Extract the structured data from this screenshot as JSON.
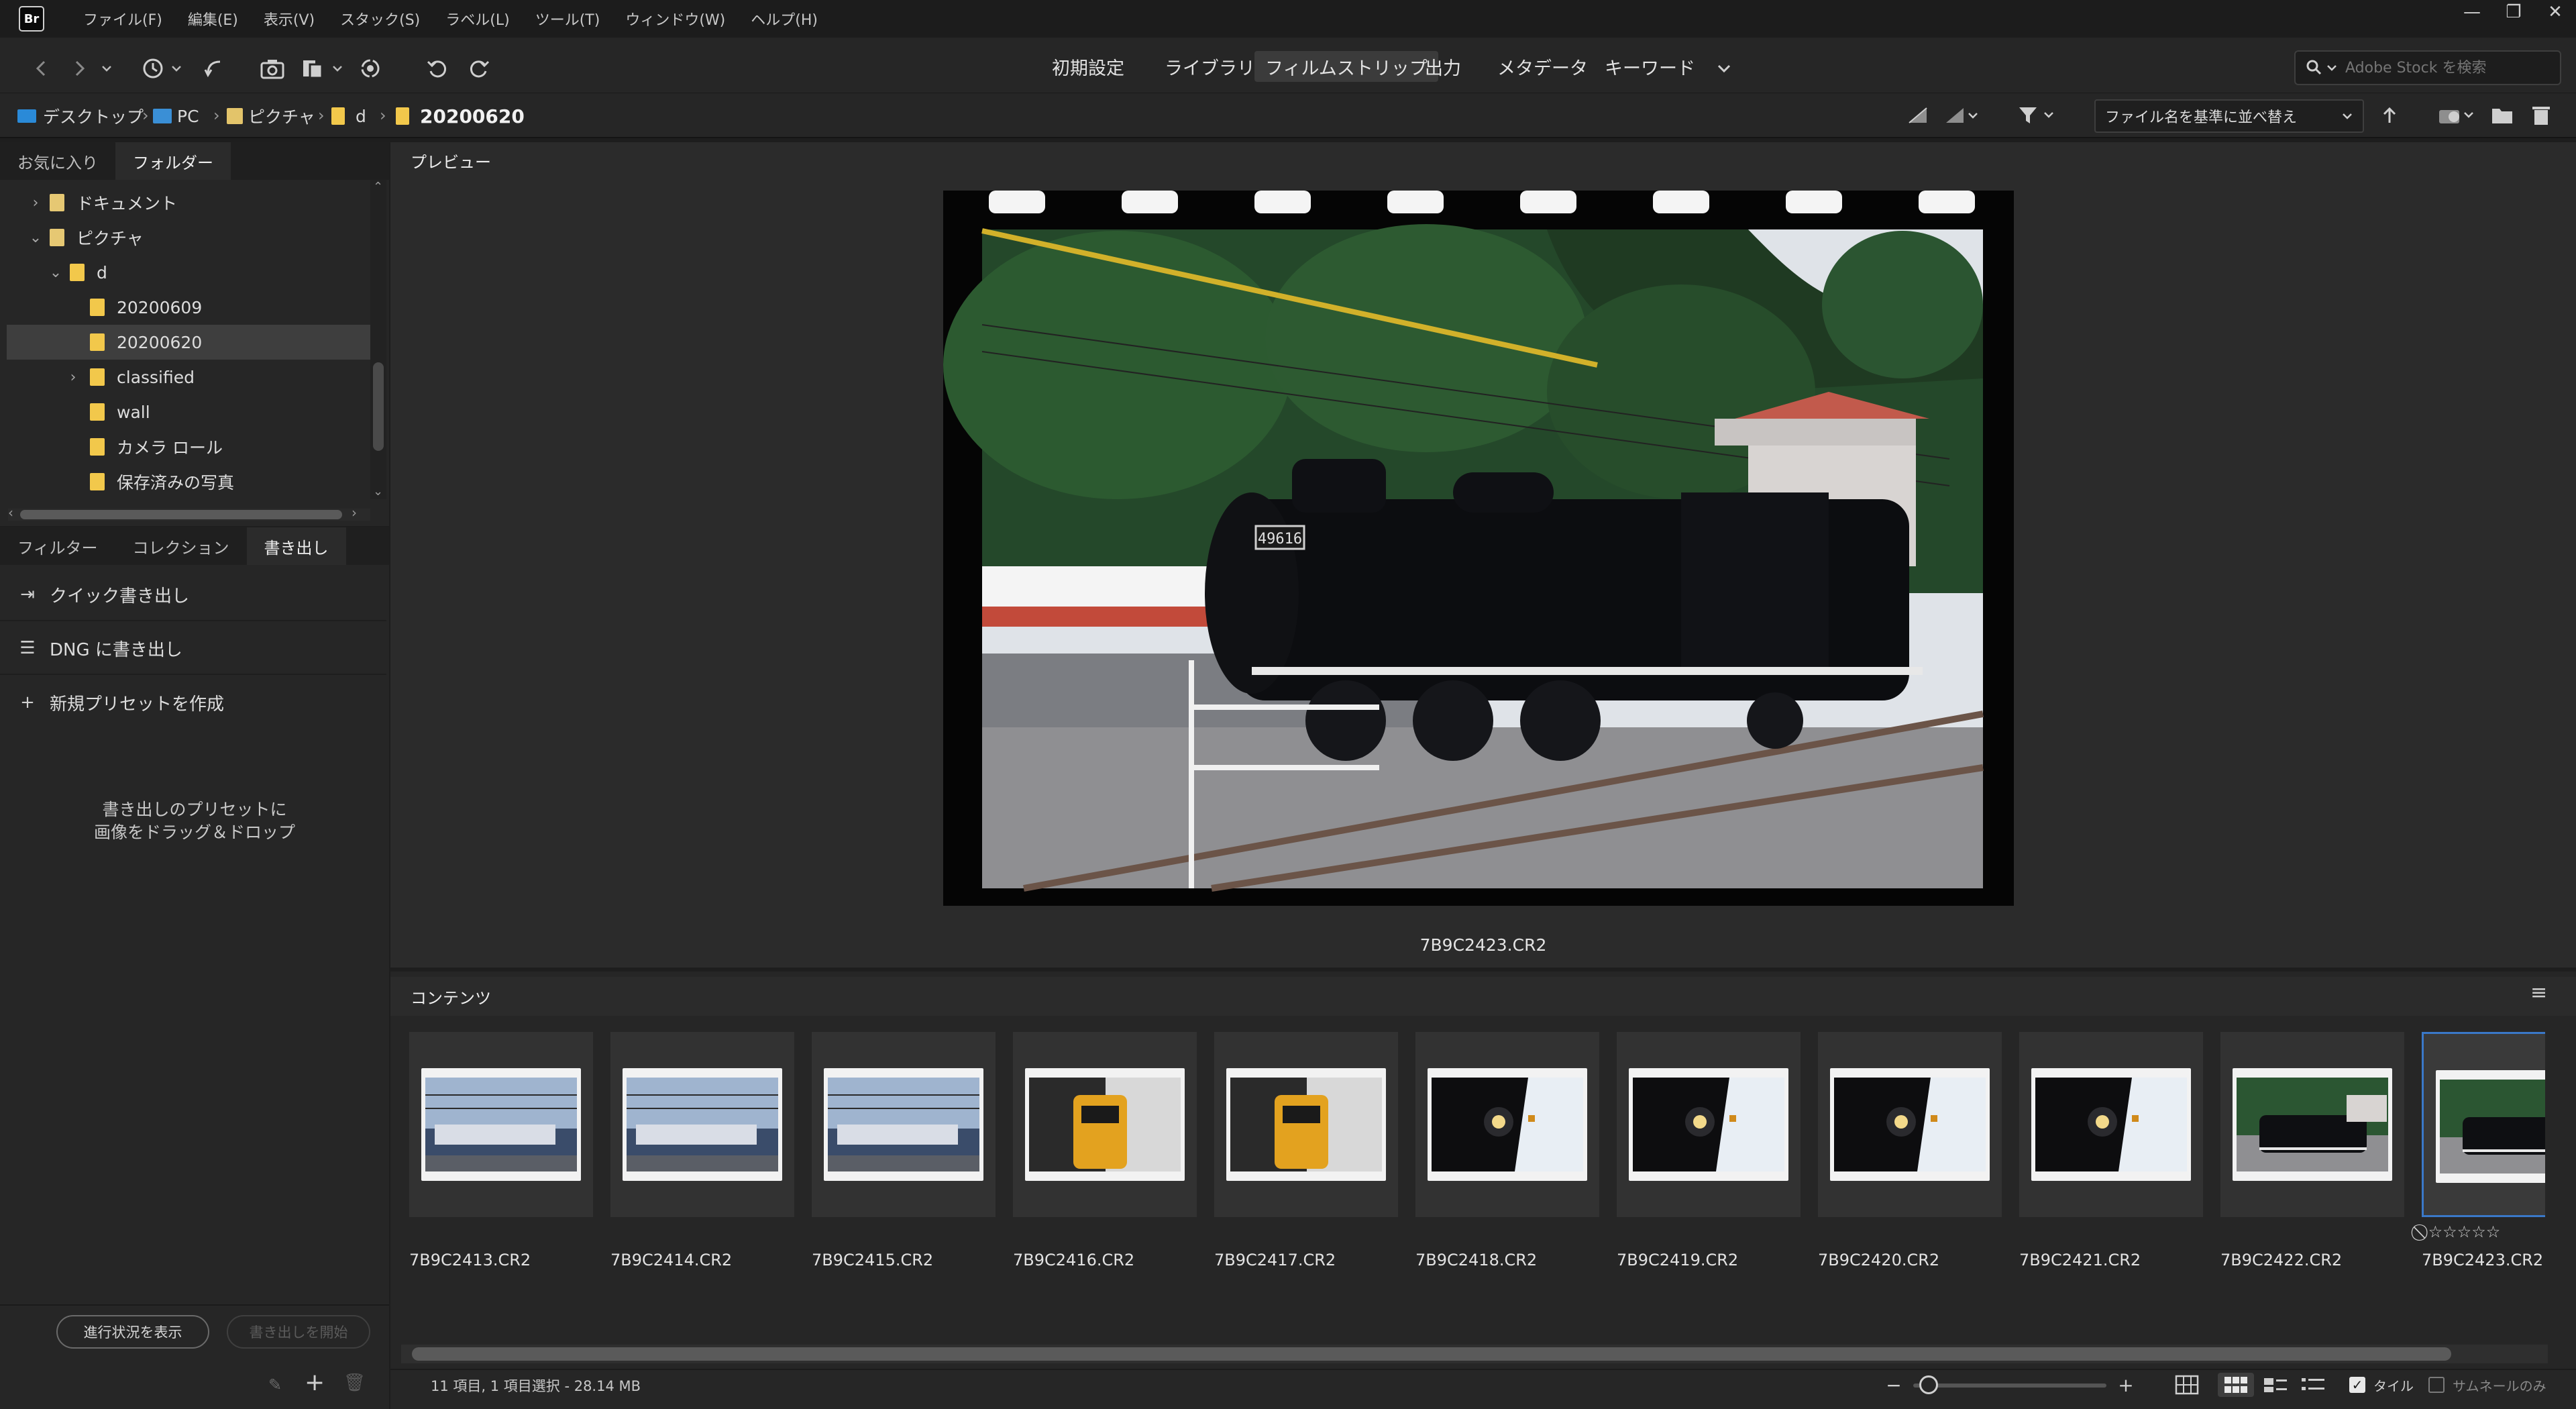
{
  "app": {
    "logo": "Br",
    "accent": "#3a78c8"
  },
  "menu": [
    "ファイル(F)",
    "編集(E)",
    "表示(V)",
    "スタック(S)",
    "ラベル(L)",
    "ツール(T)",
    "ウィンドウ(W)",
    "ヘルプ(H)"
  ],
  "window_controls": {
    "minimize": "—",
    "restore": "❐",
    "close": "✕"
  },
  "workspaces": [
    "初期設定",
    "ライブラリ",
    "フィルムストリップ",
    "出力",
    "メタデータ",
    "キーワード"
  ],
  "active_workspace": "フィルムストリップ",
  "search": {
    "placeholder": "Adobe Stock を検索"
  },
  "breadcrumb": [
    "デスクトップ",
    "PC",
    "ピクチャ",
    "d",
    "20200620"
  ],
  "sort": {
    "label": "ファイル名を基準に並べ替え"
  },
  "left_top_tabs": [
    "お気に入り",
    "フォルダー"
  ],
  "folder_tree": [
    {
      "label": "ドキュメント",
      "chevron": "›"
    },
    {
      "label": "ピクチャ",
      "chevron": "⌄"
    },
    {
      "label": "d",
      "chevron": "⌄"
    },
    {
      "label": "20200609",
      "chevron": ""
    },
    {
      "label": "20200620",
      "chevron": "",
      "selected": true
    },
    {
      "label": "classified",
      "chevron": "›"
    },
    {
      "label": "wall",
      "chevron": ""
    },
    {
      "label": "カメラ ロール",
      "chevron": ""
    },
    {
      "label": "保存済みの写真",
      "chevron": ""
    }
  ],
  "left_bottom_tabs": [
    "フィルター",
    "コレクション",
    "書き出し"
  ],
  "export": {
    "items": [
      "クイック書き出し",
      "DNG に書き出し",
      "新規プリセットを作成"
    ],
    "drop_hint_line1": "書き出しのプリセットに",
    "drop_hint_line2": "画像をドラッグ＆ドロップ",
    "progress_button": "進行状況を表示",
    "start_button": "書き出しを開始"
  },
  "preview": {
    "tab": "プレビュー",
    "filename": "7B9C2423.CR2",
    "plate_number": "49616"
  },
  "content": {
    "tab": "コンテンツ",
    "thumbnails": [
      {
        "name": "7B9C2413.CR2",
        "kind": "station"
      },
      {
        "name": "7B9C2414.CR2",
        "kind": "station"
      },
      {
        "name": "7B9C2415.CR2",
        "kind": "station"
      },
      {
        "name": "7B9C2416.CR2",
        "kind": "yellow"
      },
      {
        "name": "7B9C2417.CR2",
        "kind": "yellow"
      },
      {
        "name": "7B9C2418.CR2",
        "kind": "front"
      },
      {
        "name": "7B9C2419.CR2",
        "kind": "front"
      },
      {
        "name": "7B9C2420.CR2",
        "kind": "front"
      },
      {
        "name": "7B9C2421.CR2",
        "kind": "front"
      },
      {
        "name": "7B9C2422.CR2",
        "kind": "side"
      },
      {
        "name": "7B9C2423.CR2",
        "kind": "side",
        "selected": true
      }
    ],
    "rating": {
      "reject": "⃠",
      "stars": "☆☆☆☆☆"
    }
  },
  "status": {
    "text": "11 項目, 1 項目選択 - 28.14 MB",
    "zoom_level": 0.08,
    "tile_label": "タイル",
    "thumb_only_label": "サムネールのみ",
    "tile_checked": true
  }
}
